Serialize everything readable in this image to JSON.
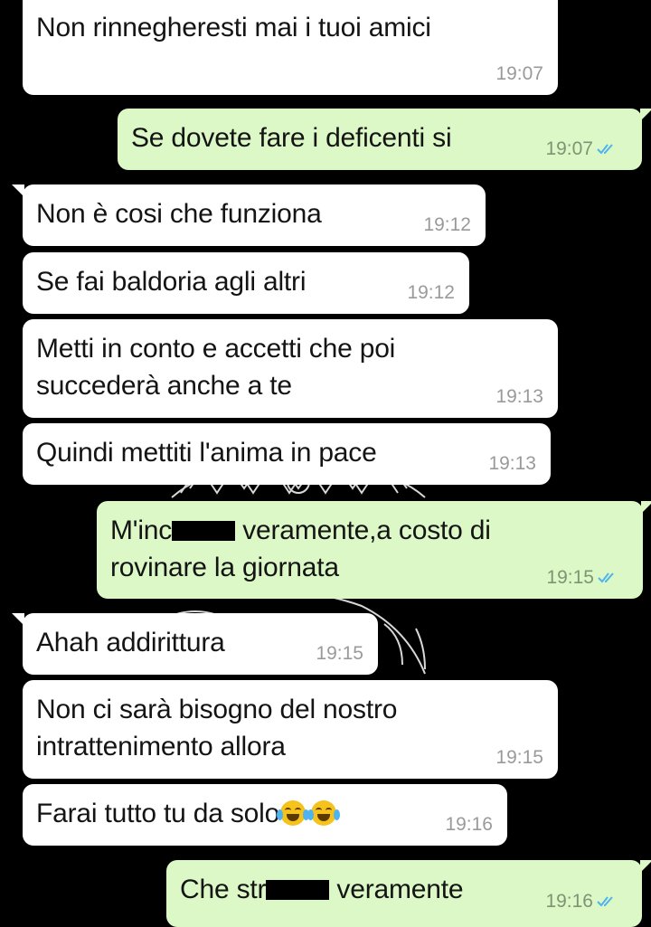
{
  "colors": {
    "background": "#000000",
    "incoming_bubble": "#ffffff",
    "outgoing_bubble": "#dcf8c6",
    "read_checks": "#4fb3ef"
  },
  "messages": [
    {
      "text": "Non rinnegheresti mai i tuoi amici",
      "time": "19:07"
    },
    {
      "text": "Se dovete fare i deficenti si",
      "time": "19:07",
      "status_icon": "double-check-read-icon"
    },
    {
      "text": "Non è cosi che funziona",
      "time": "19:12"
    },
    {
      "text": "Se fai baldoria agli altri",
      "time": "19:12"
    },
    {
      "line1": "Metti in conto e accetti che poi",
      "line2": "succederà anche a te",
      "time": "19:13"
    },
    {
      "text": "Quindi mettiti l'anima in pace",
      "time": "19:13"
    },
    {
      "part1": "M'inc",
      "part2": " veramente,a costo di",
      "line2": "rovinare la giornata",
      "time": "19:15",
      "status_icon": "double-check-read-icon"
    },
    {
      "text": "Ahah addirittura",
      "time": "19:15"
    },
    {
      "line1": "Non ci sarà bisogno del nostro",
      "line2": "intrattenimento allora",
      "time": "19:15"
    },
    {
      "text": "Farai tutto tu da solo",
      "emoji": "face-with-tears-of-joy-icon",
      "time": "19:16"
    },
    {
      "part1": "Che str",
      "part2": " veramente",
      "time": "19:16",
      "status_icon": "double-check-read-icon"
    }
  ]
}
